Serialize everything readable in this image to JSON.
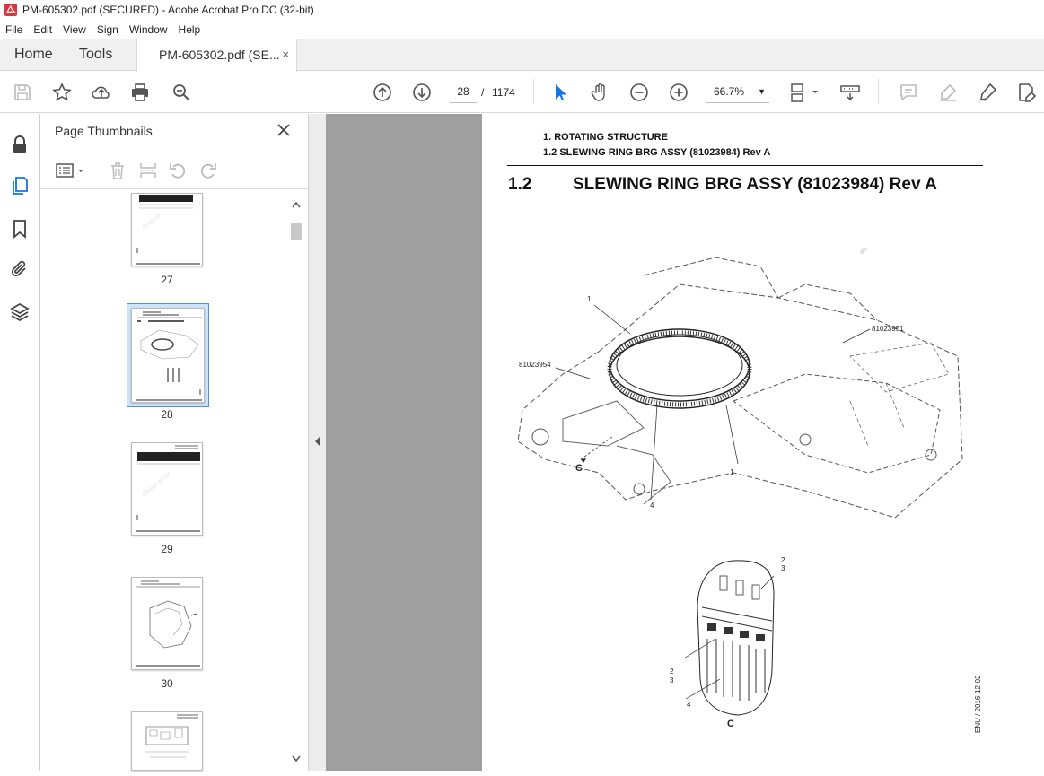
{
  "window": {
    "title": "PM-605302.pdf (SECURED) - Adobe Acrobat Pro DC (32-bit)"
  },
  "menu": [
    "File",
    "Edit",
    "View",
    "Sign",
    "Window",
    "Help"
  ],
  "tabs": {
    "home": "Home",
    "tools": "Tools",
    "document": "PM-605302.pdf (SE...",
    "close": "×"
  },
  "toolbar": {
    "page_current": "28",
    "page_separator": "/",
    "page_total": "1174",
    "zoom": "66.7%"
  },
  "thumbnails": {
    "title": "Page Thumbnails",
    "pages": [
      {
        "num": "27"
      },
      {
        "num": "28",
        "selected": true
      },
      {
        "num": "29"
      },
      {
        "num": "30"
      }
    ]
  },
  "document": {
    "header_line1": "1. ROTATING STRUCTURE",
    "header_line2": "1.2 SLEWING RING BRG ASSY (81023984) Rev A",
    "section_number": "1.2",
    "section_title": "SLEWING RING BRG ASSY (81023984) Rev A",
    "callouts": {
      "c1_top": "1",
      "c_81023951": "81023951",
      "c_81023954": "81023954",
      "c_C_upper": "C",
      "c4_upper": "4",
      "c1_lower": "1",
      "c2_detail_top": "2",
      "c3_detail_top": "3",
      "c2_detail_left": "2",
      "c3_detail_left": "3",
      "c4_detail": "4",
      "c_C_detail": "C"
    },
    "side_code": "ENU / 2016-12-02"
  },
  "colors": {
    "accent": "#1473e6",
    "doc_bg": "#9f9f9f",
    "selection": "#cde3f6"
  }
}
